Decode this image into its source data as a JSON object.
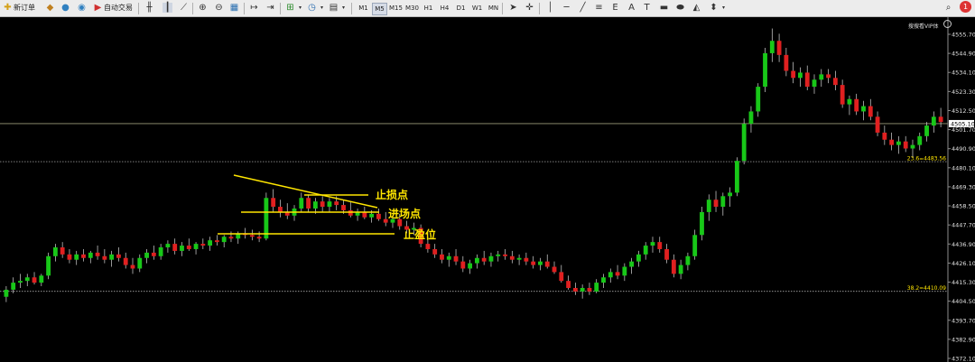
{
  "toolbar": {
    "new_order_label": "新订单",
    "auto_trade_label": "自动交易",
    "timeframes": [
      "M1",
      "M5",
      "M15",
      "M30",
      "H1",
      "H4",
      "D1",
      "W1",
      "MN"
    ],
    "active_timeframe": "M5",
    "alert_badge": "1"
  },
  "chart": {
    "header_label": "搜搜看VIP体",
    "y_ticks": [
      "4555.70",
      "4544.90",
      "4534.10",
      "4523.30",
      "4512.50",
      "4501.70",
      "4490.90",
      "4480.10",
      "4469.30",
      "4458.50",
      "4447.70",
      "4436.90",
      "4426.10",
      "4415.30",
      "4404.50",
      "4393.70",
      "4382.90",
      "4372.10"
    ],
    "current_price": "4505.10",
    "fib_levels": [
      {
        "label": "23.6=4483.56",
        "value": 4483.56
      },
      {
        "label": "38.2=4410.09",
        "value": 4410.09
      }
    ],
    "annotations": {
      "stop_loss": "止损点",
      "entry": "进场点",
      "take_profit": "止盈位"
    },
    "colors": {
      "up": "#18c818",
      "down": "#e02020",
      "background": "#000000",
      "annotation": "#ffe600",
      "current_line": "#9a9a7a"
    }
  },
  "chart_data": {
    "type": "candlestick",
    "ylim": [
      4372.1,
      4562.0
    ],
    "candles": [
      {
        "o": 4407,
        "h": 4413,
        "l": 4404,
        "c": 4411
      },
      {
        "o": 4411,
        "h": 4418,
        "l": 4409,
        "c": 4415
      },
      {
        "o": 4415,
        "h": 4420,
        "l": 4412,
        "c": 4416
      },
      {
        "o": 4416,
        "h": 4420,
        "l": 4413,
        "c": 4418
      },
      {
        "o": 4418,
        "h": 4421,
        "l": 4414,
        "c": 4415
      },
      {
        "o": 4415,
        "h": 4420,
        "l": 4413,
        "c": 4419
      },
      {
        "o": 4419,
        "h": 4432,
        "l": 4417,
        "c": 4430
      },
      {
        "o": 4430,
        "h": 4437,
        "l": 4427,
        "c": 4435
      },
      {
        "o": 4435,
        "h": 4438,
        "l": 4429,
        "c": 4431
      },
      {
        "o": 4431,
        "h": 4434,
        "l": 4426,
        "c": 4428
      },
      {
        "o": 4428,
        "h": 4433,
        "l": 4425,
        "c": 4431
      },
      {
        "o": 4431,
        "h": 4434,
        "l": 4427,
        "c": 4429
      },
      {
        "o": 4429,
        "h": 4433,
        "l": 4426,
        "c": 4432
      },
      {
        "o": 4432,
        "h": 4436,
        "l": 4428,
        "c": 4430
      },
      {
        "o": 4430,
        "h": 4434,
        "l": 4426,
        "c": 4428
      },
      {
        "o": 4428,
        "h": 4433,
        "l": 4424,
        "c": 4431
      },
      {
        "o": 4431,
        "h": 4435,
        "l": 4427,
        "c": 4429
      },
      {
        "o": 4429,
        "h": 4432,
        "l": 4423,
        "c": 4425
      },
      {
        "o": 4425,
        "h": 4429,
        "l": 4420,
        "c": 4423
      },
      {
        "o": 4423,
        "h": 4431,
        "l": 4421,
        "c": 4429
      },
      {
        "o": 4429,
        "h": 4434,
        "l": 4426,
        "c": 4432
      },
      {
        "o": 4432,
        "h": 4436,
        "l": 4428,
        "c": 4430
      },
      {
        "o": 4430,
        "h": 4437,
        "l": 4428,
        "c": 4435
      },
      {
        "o": 4435,
        "h": 4439,
        "l": 4432,
        "c": 4437
      },
      {
        "o": 4437,
        "h": 4440,
        "l": 4431,
        "c": 4433
      },
      {
        "o": 4433,
        "h": 4438,
        "l": 4430,
        "c": 4436
      },
      {
        "o": 4436,
        "h": 4440,
        "l": 4433,
        "c": 4434
      },
      {
        "o": 4434,
        "h": 4438,
        "l": 4431,
        "c": 4437
      },
      {
        "o": 4437,
        "h": 4440,
        "l": 4434,
        "c": 4436
      },
      {
        "o": 4436,
        "h": 4441,
        "l": 4433,
        "c": 4439
      },
      {
        "o": 4439,
        "h": 4442,
        "l": 4436,
        "c": 4438
      },
      {
        "o": 4438,
        "h": 4442,
        "l": 4435,
        "c": 4441
      },
      {
        "o": 4441,
        "h": 4444,
        "l": 4438,
        "c": 4440
      },
      {
        "o": 4440,
        "h": 4444,
        "l": 4437,
        "c": 4443
      },
      {
        "o": 4443,
        "h": 4446,
        "l": 4440,
        "c": 4442
      },
      {
        "o": 4442,
        "h": 4445,
        "l": 4439,
        "c": 4441
      },
      {
        "o": 4441,
        "h": 4444,
        "l": 4438,
        "c": 4440
      },
      {
        "o": 4440,
        "h": 4466,
        "l": 4439,
        "c": 4463
      },
      {
        "o": 4463,
        "h": 4468,
        "l": 4455,
        "c": 4458
      },
      {
        "o": 4458,
        "h": 4462,
        "l": 4452,
        "c": 4455
      },
      {
        "o": 4455,
        "h": 4460,
        "l": 4451,
        "c": 4453
      },
      {
        "o": 4453,
        "h": 4459,
        "l": 4450,
        "c": 4457
      },
      {
        "o": 4457,
        "h": 4466,
        "l": 4455,
        "c": 4463
      },
      {
        "o": 4463,
        "h": 4465,
        "l": 4455,
        "c": 4457
      },
      {
        "o": 4457,
        "h": 4463,
        "l": 4454,
        "c": 4461
      },
      {
        "o": 4461,
        "h": 4464,
        "l": 4455,
        "c": 4458
      },
      {
        "o": 4458,
        "h": 4463,
        "l": 4455,
        "c": 4461
      },
      {
        "o": 4461,
        "h": 4464,
        "l": 4456,
        "c": 4459
      },
      {
        "o": 4459,
        "h": 4462,
        "l": 4454,
        "c": 4456
      },
      {
        "o": 4456,
        "h": 4461,
        "l": 4452,
        "c": 4453
      },
      {
        "o": 4453,
        "h": 4457,
        "l": 4450,
        "c": 4455
      },
      {
        "o": 4455,
        "h": 4458,
        "l": 4451,
        "c": 4452
      },
      {
        "o": 4452,
        "h": 4456,
        "l": 4449,
        "c": 4454
      },
      {
        "o": 4454,
        "h": 4457,
        "l": 4450,
        "c": 4451
      },
      {
        "o": 4451,
        "h": 4455,
        "l": 4447,
        "c": 4449
      },
      {
        "o": 4449,
        "h": 4453,
        "l": 4446,
        "c": 4451
      },
      {
        "o": 4451,
        "h": 4454,
        "l": 4445,
        "c": 4447
      },
      {
        "o": 4447,
        "h": 4450,
        "l": 4443,
        "c": 4445
      },
      {
        "o": 4445,
        "h": 4449,
        "l": 4442,
        "c": 4446
      },
      {
        "o": 4446,
        "h": 4448,
        "l": 4435,
        "c": 4437
      },
      {
        "o": 4437,
        "h": 4441,
        "l": 4432,
        "c": 4434
      },
      {
        "o": 4434,
        "h": 4437,
        "l": 4429,
        "c": 4431
      },
      {
        "o": 4431,
        "h": 4434,
        "l": 4426,
        "c": 4428
      },
      {
        "o": 4428,
        "h": 4432,
        "l": 4424,
        "c": 4430
      },
      {
        "o": 4430,
        "h": 4434,
        "l": 4425,
        "c": 4427
      },
      {
        "o": 4427,
        "h": 4430,
        "l": 4421,
        "c": 4423
      },
      {
        "o": 4423,
        "h": 4428,
        "l": 4420,
        "c": 4426
      },
      {
        "o": 4426,
        "h": 4431,
        "l": 4423,
        "c": 4429
      },
      {
        "o": 4429,
        "h": 4433,
        "l": 4425,
        "c": 4427
      },
      {
        "o": 4427,
        "h": 4432,
        "l": 4424,
        "c": 4430
      },
      {
        "o": 4430,
        "h": 4433,
        "l": 4427,
        "c": 4431
      },
      {
        "o": 4431,
        "h": 4434,
        "l": 4428,
        "c": 4430
      },
      {
        "o": 4430,
        "h": 4433,
        "l": 4426,
        "c": 4428
      },
      {
        "o": 4428,
        "h": 4431,
        "l": 4425,
        "c": 4429
      },
      {
        "o": 4429,
        "h": 4432,
        "l": 4425,
        "c": 4427
      },
      {
        "o": 4427,
        "h": 4430,
        "l": 4423,
        "c": 4425
      },
      {
        "o": 4425,
        "h": 4429,
        "l": 4422,
        "c": 4427
      },
      {
        "o": 4427,
        "h": 4431,
        "l": 4423,
        "c": 4424
      },
      {
        "o": 4424,
        "h": 4427,
        "l": 4420,
        "c": 4421
      },
      {
        "o": 4421,
        "h": 4425,
        "l": 4415,
        "c": 4416
      },
      {
        "o": 4416,
        "h": 4419,
        "l": 4411,
        "c": 4412
      },
      {
        "o": 4412,
        "h": 4415,
        "l": 4408,
        "c": 4410
      },
      {
        "o": 4410,
        "h": 4414,
        "l": 4406,
        "c": 4412
      },
      {
        "o": 4412,
        "h": 4415,
        "l": 4408,
        "c": 4410
      },
      {
        "o": 4410,
        "h": 4417,
        "l": 4409,
        "c": 4415
      },
      {
        "o": 4415,
        "h": 4420,
        "l": 4412,
        "c": 4418
      },
      {
        "o": 4418,
        "h": 4423,
        "l": 4415,
        "c": 4421
      },
      {
        "o": 4421,
        "h": 4425,
        "l": 4417,
        "c": 4419
      },
      {
        "o": 4419,
        "h": 4426,
        "l": 4416,
        "c": 4424
      },
      {
        "o": 4424,
        "h": 4429,
        "l": 4420,
        "c": 4427
      },
      {
        "o": 4427,
        "h": 4433,
        "l": 4424,
        "c": 4431
      },
      {
        "o": 4431,
        "h": 4438,
        "l": 4428,
        "c": 4436
      },
      {
        "o": 4436,
        "h": 4441,
        "l": 4432,
        "c": 4438
      },
      {
        "o": 4438,
        "h": 4441,
        "l": 4432,
        "c": 4434
      },
      {
        "o": 4434,
        "h": 4437,
        "l": 4426,
        "c": 4428
      },
      {
        "o": 4428,
        "h": 4431,
        "l": 4418,
        "c": 4420
      },
      {
        "o": 4420,
        "h": 4428,
        "l": 4417,
        "c": 4425
      },
      {
        "o": 4425,
        "h": 4432,
        "l": 4422,
        "c": 4430
      },
      {
        "o": 4430,
        "h": 4445,
        "l": 4428,
        "c": 4442
      },
      {
        "o": 4442,
        "h": 4458,
        "l": 4439,
        "c": 4455
      },
      {
        "o": 4455,
        "h": 4465,
        "l": 4450,
        "c": 4462
      },
      {
        "o": 4462,
        "h": 4467,
        "l": 4455,
        "c": 4458
      },
      {
        "o": 4458,
        "h": 4466,
        "l": 4453,
        "c": 4464
      },
      {
        "o": 4464,
        "h": 4469,
        "l": 4458,
        "c": 4466
      },
      {
        "o": 4466,
        "h": 4486,
        "l": 4464,
        "c": 4484
      },
      {
        "o": 4484,
        "h": 4508,
        "l": 4482,
        "c": 4505
      },
      {
        "o": 4505,
        "h": 4515,
        "l": 4500,
        "c": 4512
      },
      {
        "o": 4512,
        "h": 4528,
        "l": 4509,
        "c": 4526
      },
      {
        "o": 4526,
        "h": 4548,
        "l": 4523,
        "c": 4545
      },
      {
        "o": 4545,
        "h": 4559,
        "l": 4540,
        "c": 4552
      },
      {
        "o": 4552,
        "h": 4556,
        "l": 4540,
        "c": 4544
      },
      {
        "o": 4544,
        "h": 4548,
        "l": 4532,
        "c": 4535
      },
      {
        "o": 4535,
        "h": 4540,
        "l": 4528,
        "c": 4531
      },
      {
        "o": 4531,
        "h": 4537,
        "l": 4526,
        "c": 4534
      },
      {
        "o": 4534,
        "h": 4538,
        "l": 4524,
        "c": 4526
      },
      {
        "o": 4526,
        "h": 4533,
        "l": 4522,
        "c": 4530
      },
      {
        "o": 4530,
        "h": 4536,
        "l": 4526,
        "c": 4533
      },
      {
        "o": 4533,
        "h": 4536,
        "l": 4528,
        "c": 4531
      },
      {
        "o": 4531,
        "h": 4535,
        "l": 4524,
        "c": 4527
      },
      {
        "o": 4527,
        "h": 4530,
        "l": 4514,
        "c": 4516
      },
      {
        "o": 4516,
        "h": 4521,
        "l": 4510,
        "c": 4519
      },
      {
        "o": 4519,
        "h": 4522,
        "l": 4510,
        "c": 4512
      },
      {
        "o": 4512,
        "h": 4518,
        "l": 4507,
        "c": 4515
      },
      {
        "o": 4515,
        "h": 4519,
        "l": 4507,
        "c": 4509
      },
      {
        "o": 4509,
        "h": 4512,
        "l": 4498,
        "c": 4500
      },
      {
        "o": 4500,
        "h": 4504,
        "l": 4493,
        "c": 4496
      },
      {
        "o": 4496,
        "h": 4500,
        "l": 4490,
        "c": 4493
      },
      {
        "o": 4493,
        "h": 4498,
        "l": 4488,
        "c": 4495
      },
      {
        "o": 4495,
        "h": 4498,
        "l": 4489,
        "c": 4491
      },
      {
        "o": 4491,
        "h": 4496,
        "l": 4486,
        "c": 4493
      },
      {
        "o": 4493,
        "h": 4500,
        "l": 4490,
        "c": 4498
      },
      {
        "o": 4498,
        "h": 4506,
        "l": 4495,
        "c": 4504
      },
      {
        "o": 4504,
        "h": 4512,
        "l": 4500,
        "c": 4509
      },
      {
        "o": 4509,
        "h": 4514,
        "l": 4503,
        "c": 4506
      }
    ]
  }
}
